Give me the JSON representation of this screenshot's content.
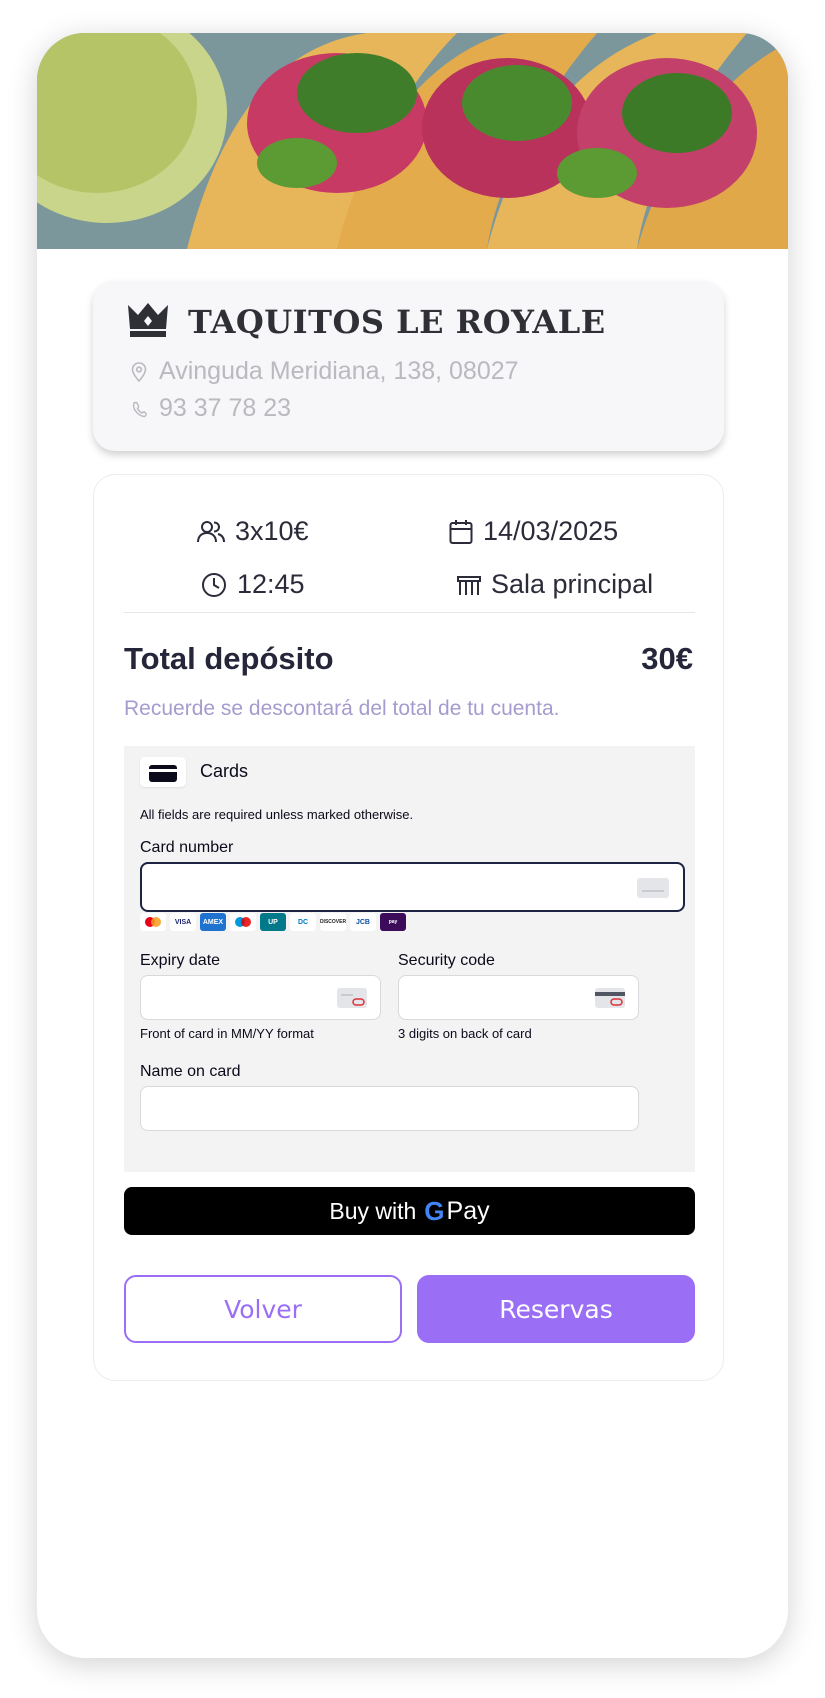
{
  "restaurant": {
    "name": "TAQUITOS LE ROYALE",
    "address": "Avinguda Meridiana, 138, 08027",
    "phone": "93 37 78 23"
  },
  "booking": {
    "guests": "3x10€",
    "date": "14/03/2025",
    "time": "12:45",
    "room": "Sala principal"
  },
  "deposit": {
    "label": "Total depósito",
    "amount": "30€",
    "note": "Recuerde se descontará del total de tu cuenta."
  },
  "payment": {
    "method_title": "Cards",
    "required_note": "All fields are required unless marked otherwise.",
    "card_number_label": "Card number",
    "card_number_value": "",
    "brands": [
      "Mastercard",
      "Visa",
      "Amex",
      "Maestro",
      "UnionPay",
      "Diners",
      "Discover",
      "JCB",
      "Alipay"
    ],
    "expiry_label": "Expiry date",
    "expiry_hint": "Front of card in MM/YY format",
    "cvc_label": "Security code",
    "cvc_hint": "3 digits on back of card",
    "name_label": "Name on card",
    "gpay_prefix": "Buy with",
    "gpay_g": "G",
    "gpay_pay": "Pay"
  },
  "actions": {
    "back": "Volver",
    "reserve": "Reservas"
  },
  "colors": {
    "accent": "#9b6ff5",
    "muted_note": "#a69bcf"
  }
}
